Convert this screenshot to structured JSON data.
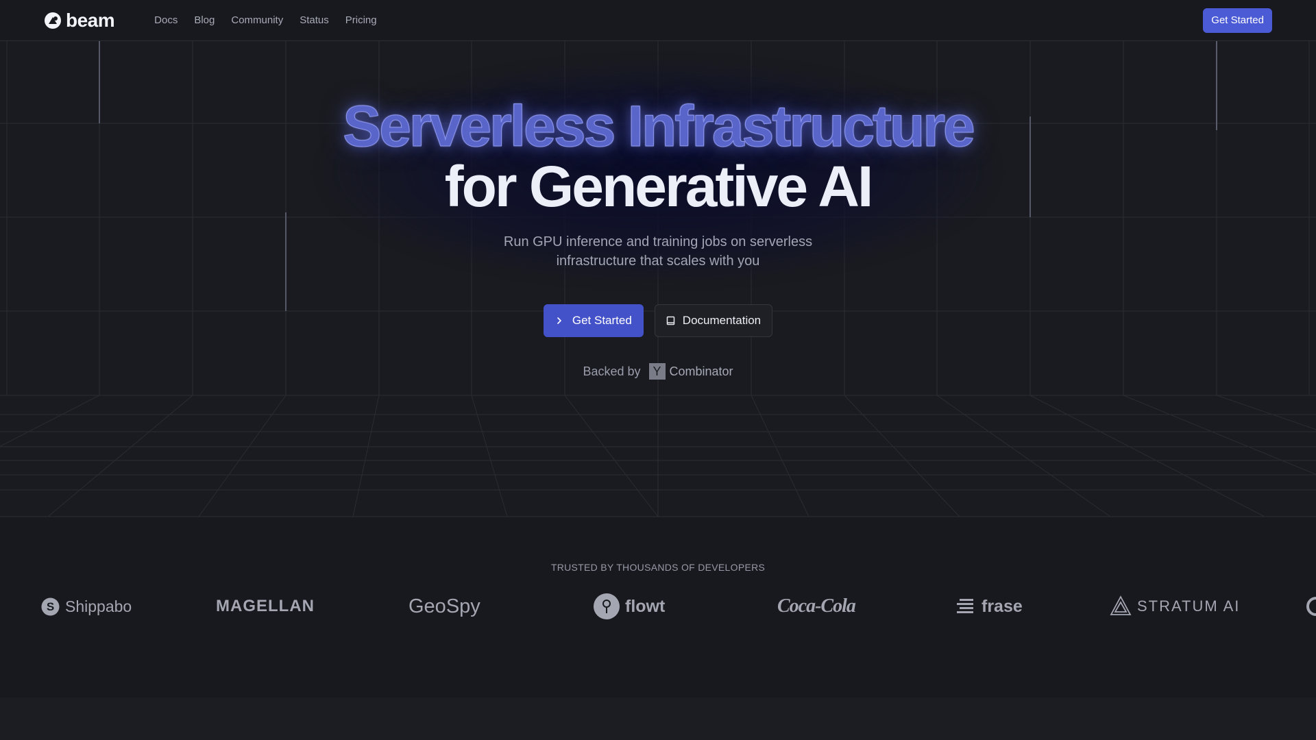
{
  "header": {
    "brand": "beam",
    "nav": [
      "Docs",
      "Blog",
      "Community",
      "Status",
      "Pricing"
    ],
    "cta_label": "Get Started"
  },
  "hero": {
    "title_line1": "Serverless Infrastructure",
    "title_line2": "for Generative AI",
    "subtitle_line1": "Run GPU inference and training jobs on serverless",
    "subtitle_line2": "infrastructure that scales with you",
    "primary_cta": "Get Started",
    "secondary_cta": "Documentation",
    "backed_by": "Backed by",
    "backer_mark": "Y",
    "backer_name": "Combinator"
  },
  "trusted": {
    "title": "TRUSTED BY THOUSANDS OF DEVELOPERS",
    "brands": [
      "Shippabo",
      "MAGELLAN",
      "GeoSpy",
      "flowt",
      "Coca-Cola",
      "frase",
      "STRATUM AI"
    ]
  },
  "colors": {
    "accent": "#4b5bd6",
    "background": "#17181d",
    "headline_glow": "#5965c8"
  },
  "icons": {
    "logo": "beam-logo-icon",
    "primary_cta": "chevron-right-icon",
    "secondary_cta": "book-icon"
  }
}
